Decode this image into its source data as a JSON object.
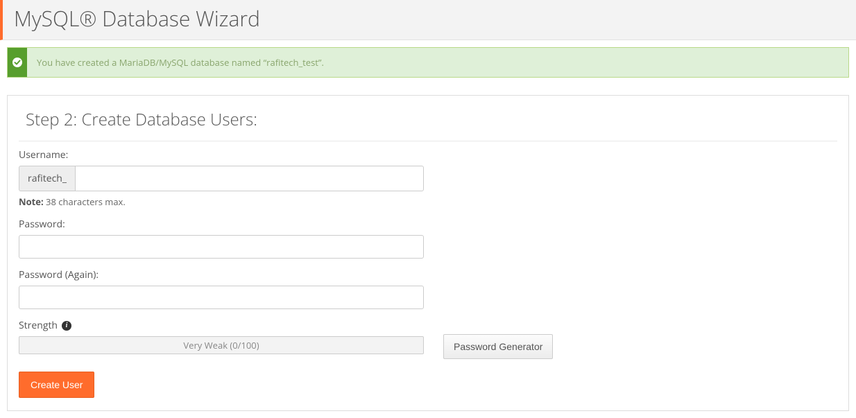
{
  "header": {
    "title": "MySQL® Database Wizard"
  },
  "alert": {
    "message": "You have created a MariaDB/MySQL database named “rafitech_test”."
  },
  "step_title": "Step 2: Create Database Users:",
  "form": {
    "username_label": "Username:",
    "username_prefix": "rafitech_",
    "username_value": "",
    "note_label": "Note:",
    "note_text": " 38 characters max.",
    "password_label": "Password:",
    "password_value": "",
    "password_again_label": "Password (Again):",
    "password_again_value": "",
    "strength_label": "Strength",
    "strength_meter": "Very Weak (0/100)",
    "generator_btn": "Password Generator",
    "submit_btn": "Create User"
  }
}
